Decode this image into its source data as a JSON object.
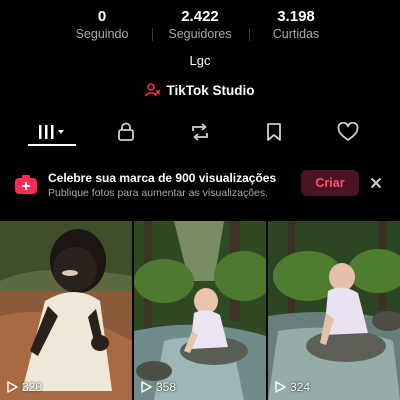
{
  "profile": {
    "stats": [
      {
        "value": "0",
        "label": "Seguindo"
      },
      {
        "value": "2.422",
        "label": "Seguidores"
      },
      {
        "value": "3.198",
        "label": "Curtidas"
      }
    ],
    "bio": "Lgc",
    "studio_label": "TikTok Studio"
  },
  "tabs": [
    {
      "icon": "videos-grid-icon",
      "selected": true
    },
    {
      "icon": "lock-icon",
      "selected": false
    },
    {
      "icon": "repost-icon",
      "selected": false
    },
    {
      "icon": "bookmark-icon",
      "selected": false
    },
    {
      "icon": "heart-icon",
      "selected": false
    }
  ],
  "banner": {
    "title": "Celebre sua marca de 900 visualizações",
    "subtitle": "Publique fotos para aumentar as visualizações.",
    "button_label": "Criar",
    "accent": "#fe2c55"
  },
  "videos": [
    {
      "views": "320"
    },
    {
      "views": "358"
    },
    {
      "views": "324"
    }
  ]
}
